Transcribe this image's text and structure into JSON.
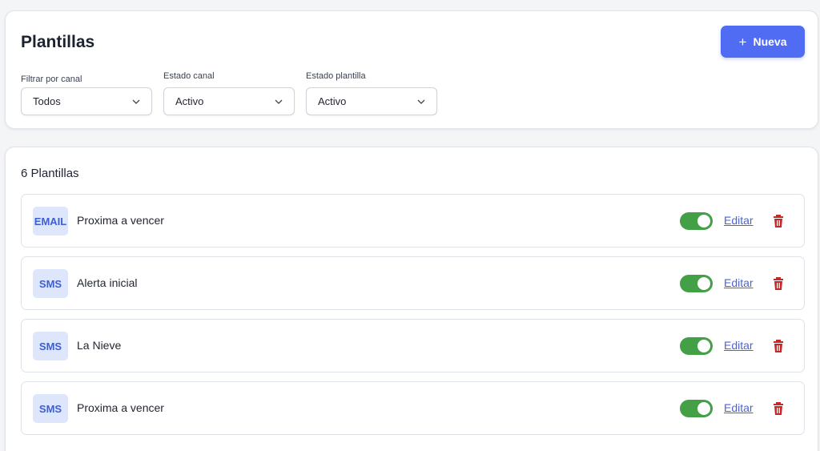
{
  "header": {
    "title": "Plantillas",
    "new_button_icon": "+",
    "new_button_label": "Nueva"
  },
  "filters": {
    "channel": {
      "label": "Filtrar por canal",
      "value": "Todos"
    },
    "channel_status": {
      "label": "Estado canal",
      "value": "Activo"
    },
    "template_status": {
      "label": "Estado plantilla",
      "value": "Activo"
    }
  },
  "list": {
    "count_label": "6 Plantillas",
    "edit_label": "Editar",
    "items": [
      {
        "channel": "EMAIL",
        "name": "Proxima a vencer",
        "active": true
      },
      {
        "channel": "SMS",
        "name": "Alerta inicial",
        "active": true
      },
      {
        "channel": "SMS",
        "name": "La Nieve",
        "active": true
      },
      {
        "channel": "SMS",
        "name": "Proxima a vencer",
        "active": true
      }
    ]
  },
  "colors": {
    "accent": "#4f6cf2",
    "toggle_on": "#43a047",
    "delete": "#c62828",
    "badge_bg": "#dde6fb",
    "badge_text": "#3d5fd0"
  }
}
